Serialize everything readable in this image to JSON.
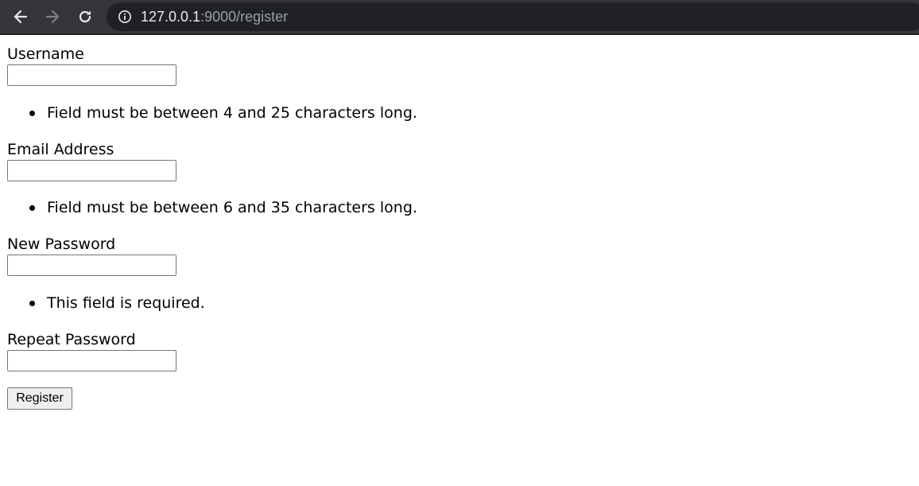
{
  "browser": {
    "url_host": "127.0.0.1",
    "url_rest": ":9000/register",
    "icons": {
      "back": "arrow-left-icon",
      "forward": "arrow-right-icon",
      "reload": "reload-icon",
      "site_info": "info-icon"
    }
  },
  "form": {
    "username": {
      "label": "Username",
      "value": "",
      "error": "Field must be between 4 and 25 characters long."
    },
    "email": {
      "label": "Email Address",
      "value": "",
      "error": "Field must be between 6 and 35 characters long."
    },
    "new_password": {
      "label": "New Password",
      "value": "",
      "error": "This field is required."
    },
    "repeat_password": {
      "label": "Repeat Password",
      "value": ""
    },
    "submit_label": "Register"
  }
}
